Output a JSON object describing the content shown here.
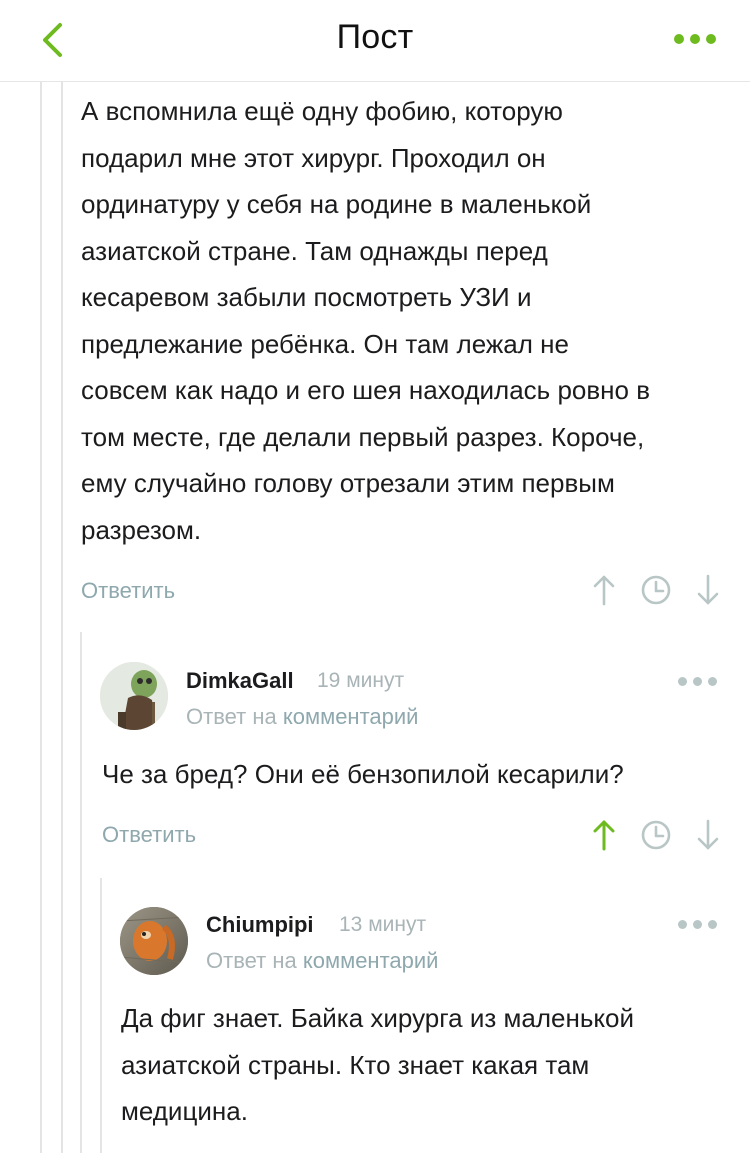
{
  "header": {
    "title": "Пост"
  },
  "comments": [
    {
      "text": "А вспомнила ещё одну фобию, которую\nподарил мне этот хирург. Проходил он\nординатуру у себя на родине в маленькой\nазиатской стране. Там однажды перед\nкесаревом забыли посмотреть УЗИ и\nпредлежание ребёнка. Он там лежал не\nсовсем как надо и его шея находилась ровно в\nтом месте, где делали первый разрез. Короче,\nему случайно голову отрезали этим первым\nразрезом.",
      "reply_label": "Ответить"
    },
    {
      "author": "DimkaGall",
      "time": "19 минут",
      "reply_prefix": "Ответ на",
      "reply_link": "комментарий",
      "text": "Че за бред? Они её бензопилой кесарили?",
      "reply_label": "Ответить",
      "upvoted": true
    },
    {
      "author": "Chiumpipi",
      "time": "13 минут",
      "reply_prefix": "Ответ на",
      "reply_link": "комментарий",
      "text": "Да фиг знает. Байка хирурга из маленькой\nазиатской страны. Кто знает какая там\nмедицина."
    }
  ],
  "colors": {
    "accent": "#6dbb1f",
    "muted": "#8ea8ad",
    "gray": "#a9b4b7",
    "thread_line": "#e4e4e4"
  },
  "icons": [
    "back-chevron-icon",
    "more-dots-icon",
    "upvote-arrow-icon",
    "clock-icon",
    "downvote-arrow-icon"
  ]
}
